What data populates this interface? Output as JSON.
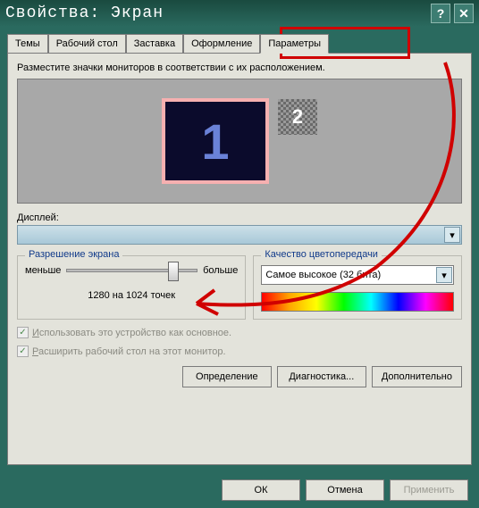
{
  "title": "Свойства: Экран",
  "tabs": [
    "Темы",
    "Рабочий стол",
    "Заставка",
    "Оформление",
    "Параметры"
  ],
  "activeTab": 4,
  "instruction": "Разместите значки мониторов в соответствии с их расположением.",
  "monitor1": "1",
  "monitor2": "2",
  "displayLabel": "Дисплей:",
  "displayValue": "",
  "resolution": {
    "legend": "Разрешение экрана",
    "less": "меньше",
    "more": "больше",
    "text": "1280 на 1024 точек"
  },
  "quality": {
    "legend": "Качество цветопередачи",
    "value": "Самое высокое (32 бита)"
  },
  "chkPrimaryLetter": "И",
  "chkPrimaryRest": "спользовать это устройство как основное.",
  "chkExtendLetter": "Р",
  "chkExtendRest": "асширить рабочий стол на этот монитор.",
  "btns": {
    "identify": "Определение",
    "diag": "Диагностика...",
    "adv": "Дополнительно"
  },
  "bottom": {
    "ok": "ОК",
    "cancel": "Отмена",
    "apply": "Применить"
  }
}
